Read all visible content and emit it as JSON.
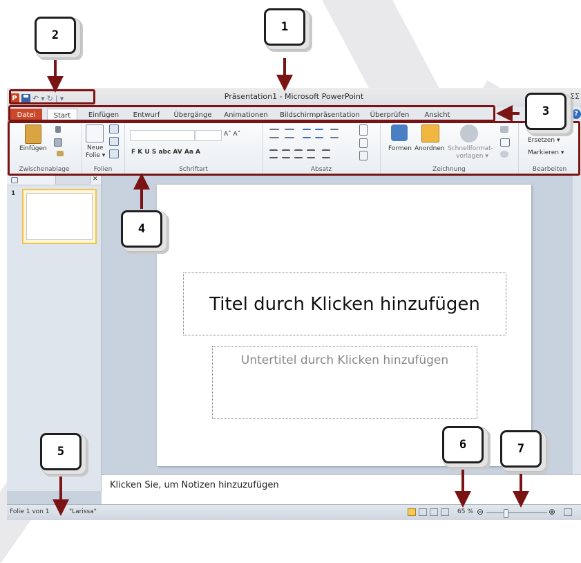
{
  "window": {
    "title": "Präsentation1  -  Microsoft PowerPoint",
    "logo_letter": "P",
    "close_glyph": "ΣΣ",
    "help_glyph": "?"
  },
  "quick_access": {
    "undo_glyph": "↶",
    "redo_glyph": "↻",
    "more_glyph": "▾",
    "separator": "|"
  },
  "tabs": [
    {
      "label": "Datei"
    },
    {
      "label": "Start"
    },
    {
      "label": "Einfügen"
    },
    {
      "label": "Entwurf"
    },
    {
      "label": "Übergänge"
    },
    {
      "label": "Animationen"
    },
    {
      "label": "Bildschirmpräsentation"
    },
    {
      "label": "Überprüfen"
    },
    {
      "label": "Ansicht"
    }
  ],
  "ribbon": {
    "groups": [
      {
        "label": "Zwischenablage"
      },
      {
        "label": "Folien"
      },
      {
        "label": "Schriftart"
      },
      {
        "label": "Absatz"
      },
      {
        "label": "Zeichnung"
      },
      {
        "label": "Bearbeiten"
      }
    ],
    "einfuegen_label": "Einfügen",
    "neue_folie_label": "Neue\nFolie",
    "neue_folie_line1": "Neue",
    "neue_folie_line2": "Folie ▾",
    "font_glyphs": "F  K  U  S  abc  AV  Aa  A",
    "grow_glyph": "A˄ A˅",
    "formen_label": "Formen",
    "anordnen_label": "Anordnen",
    "schnellformat_line1": "Schnellformat-",
    "schnellformat_line2": "vorlagen ▾",
    "ersetzen_label": "Ersetzen ▾",
    "markieren_label": "Markieren ▾",
    "dialog_glyph": "↘"
  },
  "slides_pane": {
    "slide_number": "1",
    "close_glyph": "✕"
  },
  "slide": {
    "title_placeholder": "Titel durch Klicken hinzufügen",
    "subtitle_placeholder": "Untertitel durch Klicken hinzufügen"
  },
  "notes": {
    "placeholder": "Klicken Sie, um  Notizen hinzuzufügen"
  },
  "status": {
    "slide_info": "Folie 1 von 1",
    "theme": "\"Larissa\"",
    "zoom": "65 %",
    "zoom_level_percent": 65,
    "zoom_out_glyph": "⊖",
    "zoom_in_glyph": "⊕"
  },
  "callouts": [
    {
      "number": "1"
    },
    {
      "number": "2"
    },
    {
      "number": "3"
    },
    {
      "number": "4"
    },
    {
      "number": "5"
    },
    {
      "number": "6"
    },
    {
      "number": "7"
    }
  ],
  "colors": {
    "accent": "#7a1414",
    "file_tab": "#c9492a"
  }
}
